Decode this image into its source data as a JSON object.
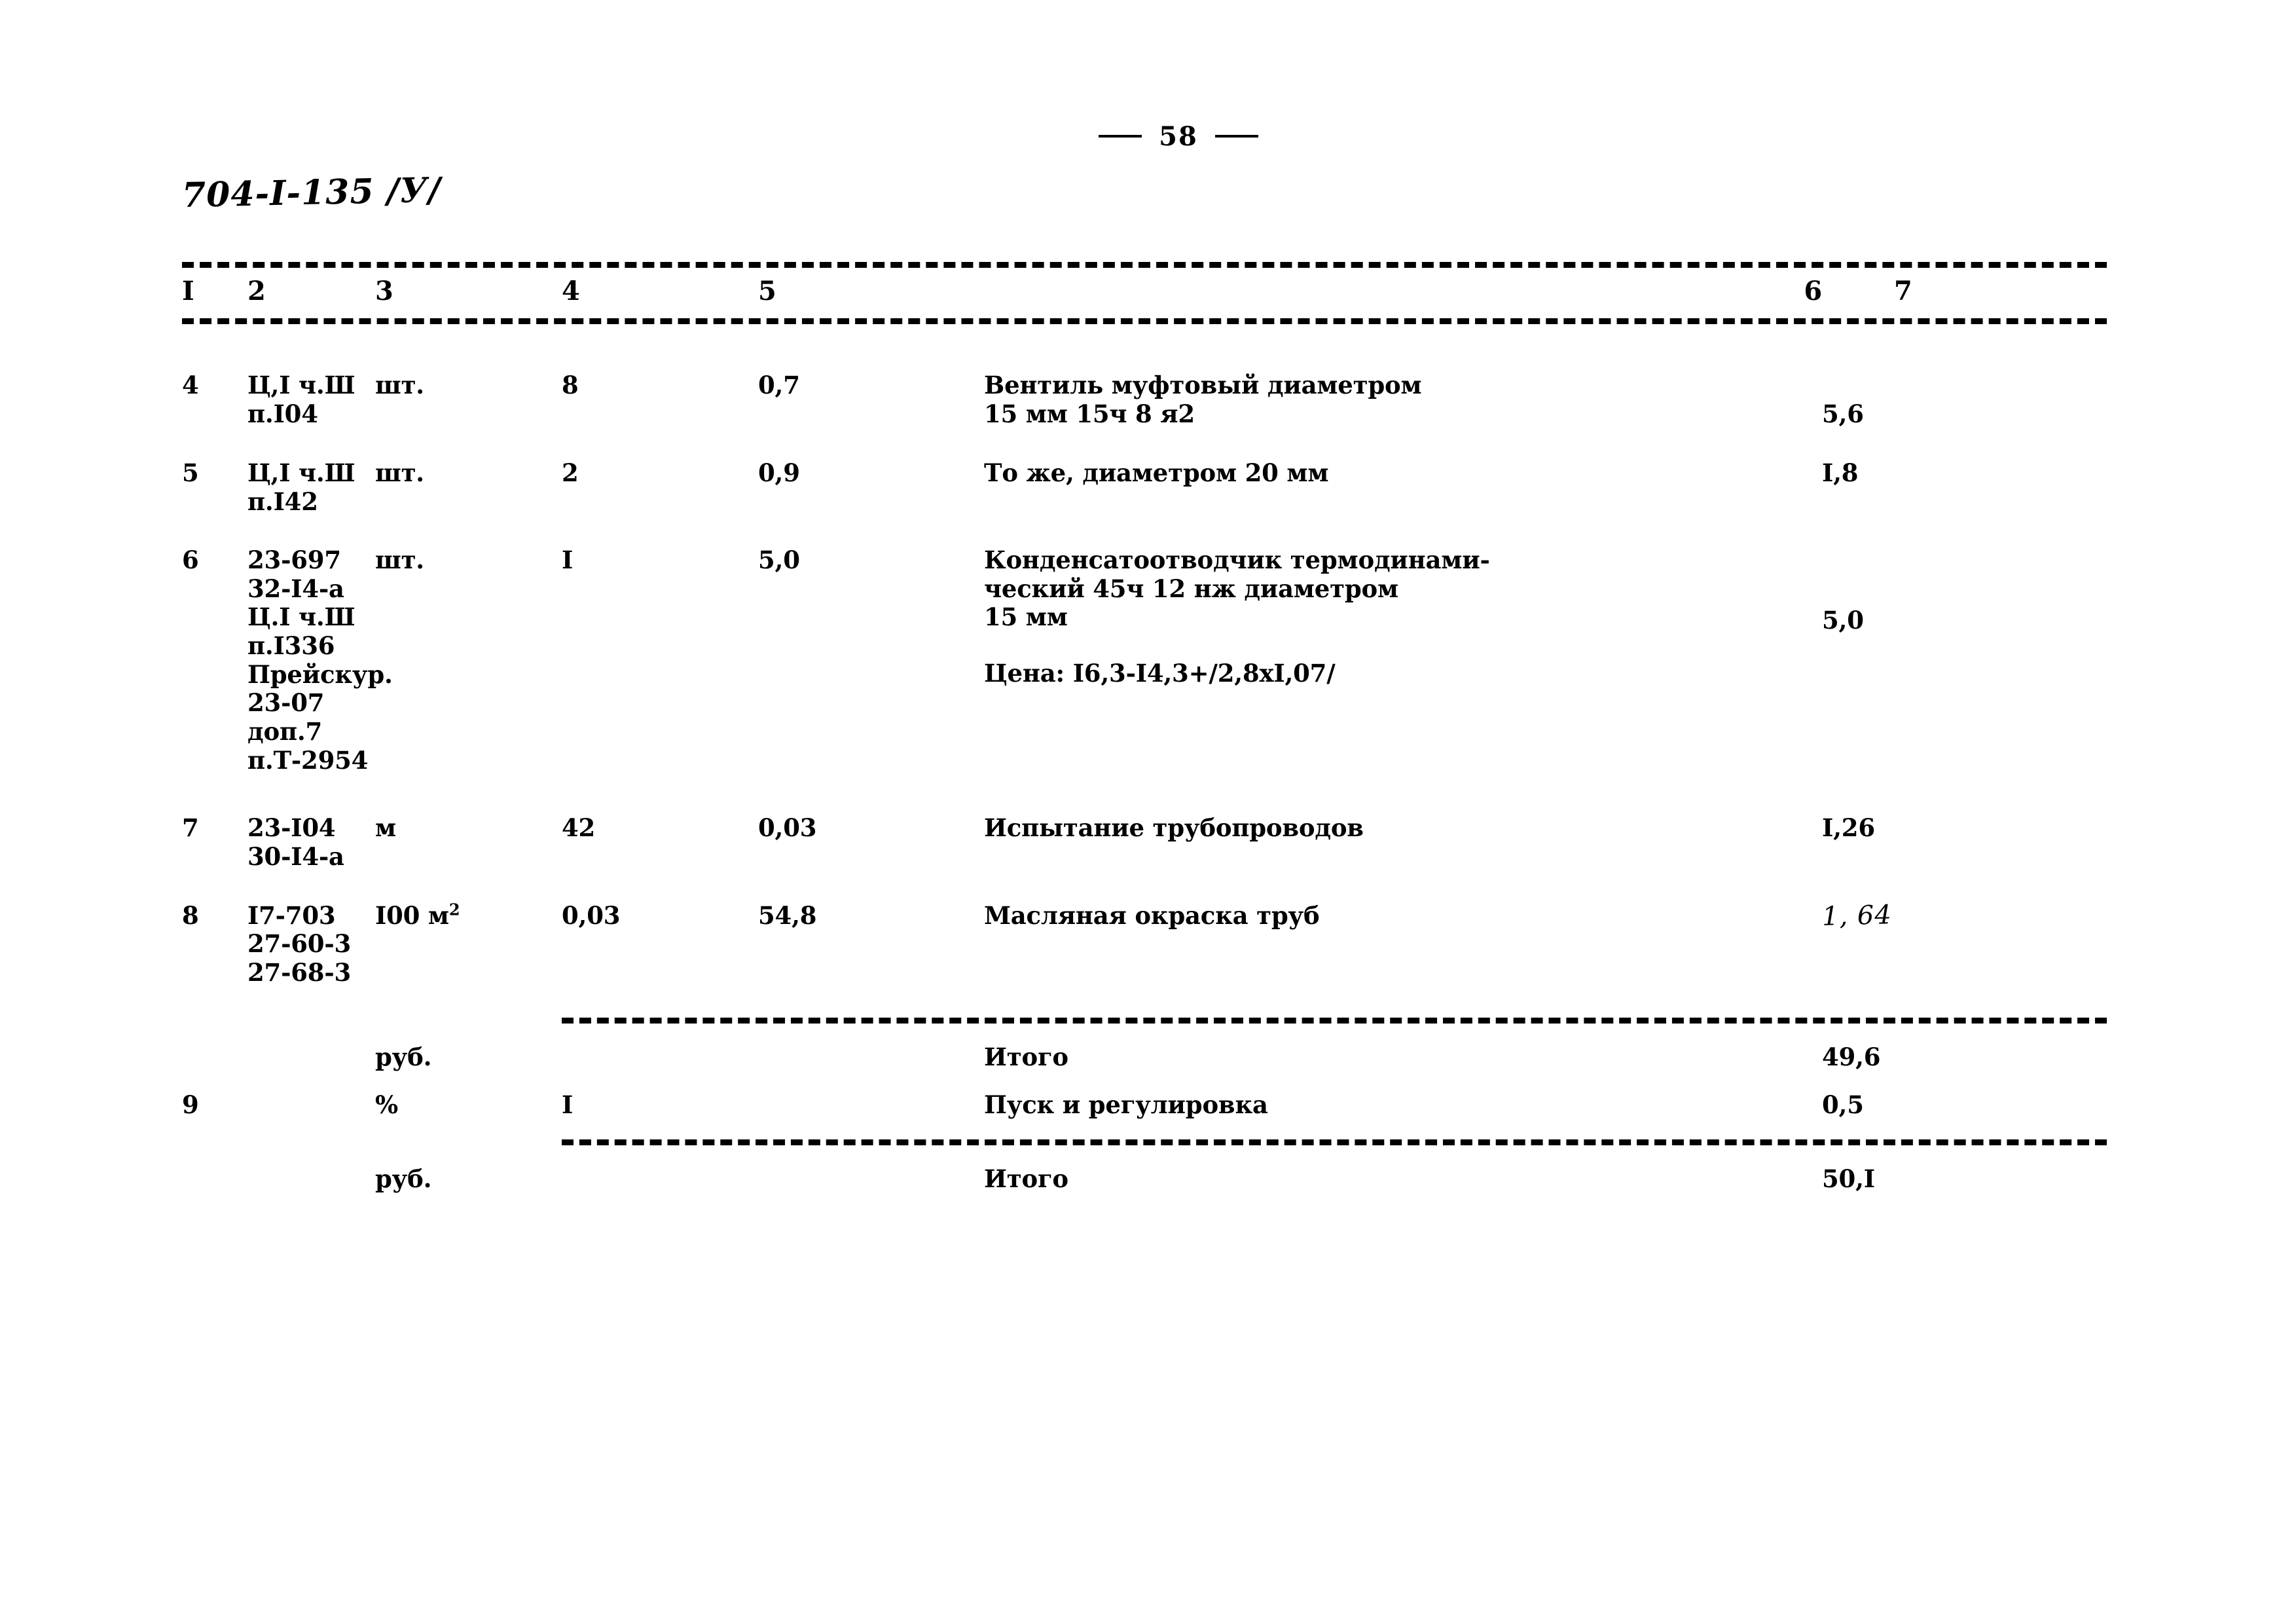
{
  "page": {
    "number": "58",
    "doc_code": "704-I-135  /У/"
  },
  "table": {
    "headers": [
      "I",
      "2",
      "3",
      "4",
      "5",
      "6",
      "7"
    ],
    "rows": [
      {
        "num": "4",
        "codes": [
          "Ц,I ч.Ш",
          "п.I04"
        ],
        "unit": "шт.",
        "qty": "8",
        "rate": "0,7",
        "desc": [
          "Вентиль муфтовый диаметром",
          "15 мм 15ч 8 я2"
        ],
        "total": "5,6",
        "handwritten": false
      },
      {
        "num": "5",
        "codes": [
          "Ц,I ч.Ш",
          "п.I42"
        ],
        "unit": "шт.",
        "qty": "2",
        "rate": "0,9",
        "desc": [
          "То же, диаметром 20 мм"
        ],
        "total": "I,8",
        "handwritten": false
      },
      {
        "num": "6",
        "codes": [
          "23-697",
          "32-I4-а",
          "Ц.I ч.Ш",
          "п.I336",
          "Прейскур.",
          "23-07",
          "доп.7",
          "п.Т-2954"
        ],
        "unit": "шт.",
        "qty": "I",
        "rate": "5,0",
        "desc": [
          "Конденсатоотводчик термодинами-",
          "ческий 45ч 12 нж диаметром",
          "15 мм"
        ],
        "note": "Цена: I6,3-I4,3+/2,8xI,07/",
        "total": "5,0",
        "handwritten": false
      },
      {
        "num": "7",
        "codes": [
          "23-I04",
          "30-I4-а"
        ],
        "unit": "м",
        "qty": "42",
        "rate": "0,03",
        "desc": [
          "Испытание трубопроводов"
        ],
        "total": "I,26",
        "handwritten": false
      },
      {
        "num": "8",
        "codes": [
          "I7-703",
          "27-60-3",
          "27-68-3"
        ],
        "unit": "I00 м",
        "unit_sup": "2",
        "qty": "0,03",
        "rate": "54,8",
        "desc": [
          "Масляная окраска труб"
        ],
        "total": "1, 64",
        "handwritten": true
      }
    ],
    "summary_1": {
      "unit": "руб.",
      "label": "Итого",
      "total": "49,6"
    },
    "row_9": {
      "num": "9",
      "unit": "%",
      "qty": "I",
      "label": "Пуск и регулировка",
      "total": "0,5"
    },
    "summary_2": {
      "unit": "руб.",
      "label": "Итого",
      "total": "50,I"
    }
  }
}
